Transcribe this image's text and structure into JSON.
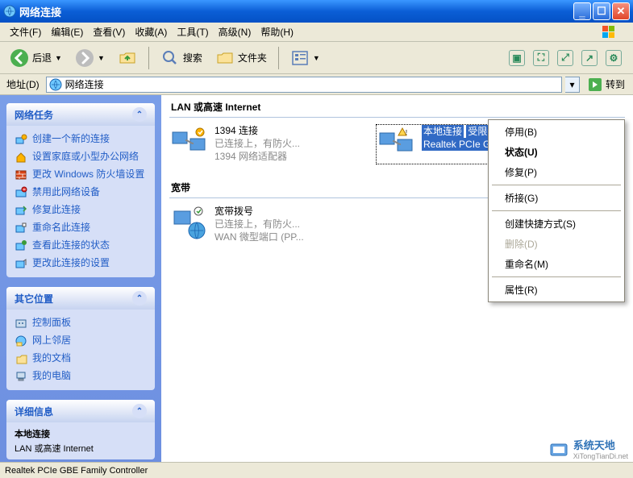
{
  "window": {
    "title": "网络连接"
  },
  "menu": {
    "items": [
      "文件(F)",
      "编辑(E)",
      "查看(V)",
      "收藏(A)",
      "工具(T)",
      "高级(N)",
      "帮助(H)"
    ]
  },
  "toolbar": {
    "back": "后退",
    "search": "搜索",
    "folders": "文件夹"
  },
  "address": {
    "label": "地址(D)",
    "value": "网络连接",
    "go": "转到"
  },
  "sidebar": {
    "network_tasks": {
      "title": "网络任务",
      "items": [
        "创建一个新的连接",
        "设置家庭或小型办公网络",
        "更改 Windows 防火墙设置",
        "禁用此网络设备",
        "修复此连接",
        "重命名此连接",
        "查看此连接的状态",
        "更改此连接的设置"
      ]
    },
    "other_places": {
      "title": "其它位置",
      "items": [
        "控制面板",
        "网上邻居",
        "我的文档",
        "我的电脑"
      ]
    },
    "details": {
      "title": "详细信息",
      "name": "本地连接",
      "category": "LAN 或高速 Internet"
    }
  },
  "content": {
    "sections": {
      "lan": {
        "title": "LAN 或高速 Internet",
        "items": [
          {
            "name": "1394 连接",
            "status": "已连接上，有防火...",
            "device": "1394 网络适配器"
          },
          {
            "name": "本地连接",
            "status": "受限制或无连接, ...",
            "device": "Realtek PCIe GBE..."
          }
        ]
      },
      "broadband": {
        "title": "宽带",
        "items": [
          {
            "name": "宽带拨号",
            "status": "已连接上，有防火...",
            "device": "WAN 微型端口 (PP..."
          }
        ]
      }
    }
  },
  "context_menu": {
    "items": [
      {
        "label": "停用(B)",
        "enabled": true,
        "bold": false
      },
      {
        "label": "状态(U)",
        "enabled": true,
        "bold": true
      },
      {
        "label": "修复(P)",
        "enabled": true,
        "bold": false
      },
      {
        "type": "sep"
      },
      {
        "label": "桥接(G)",
        "enabled": true,
        "bold": false
      },
      {
        "type": "sep"
      },
      {
        "label": "创建快捷方式(S)",
        "enabled": true,
        "bold": false
      },
      {
        "label": "删除(D)",
        "enabled": false,
        "bold": false
      },
      {
        "label": "重命名(M)",
        "enabled": true,
        "bold": false
      },
      {
        "type": "sep"
      },
      {
        "label": "属性(R)",
        "enabled": true,
        "bold": false
      }
    ]
  },
  "statusbar": {
    "text": "Realtek PCIe GBE Family Controller"
  },
  "watermark": {
    "brand": "系统天地",
    "url": "XiTongTianDi.net"
  }
}
